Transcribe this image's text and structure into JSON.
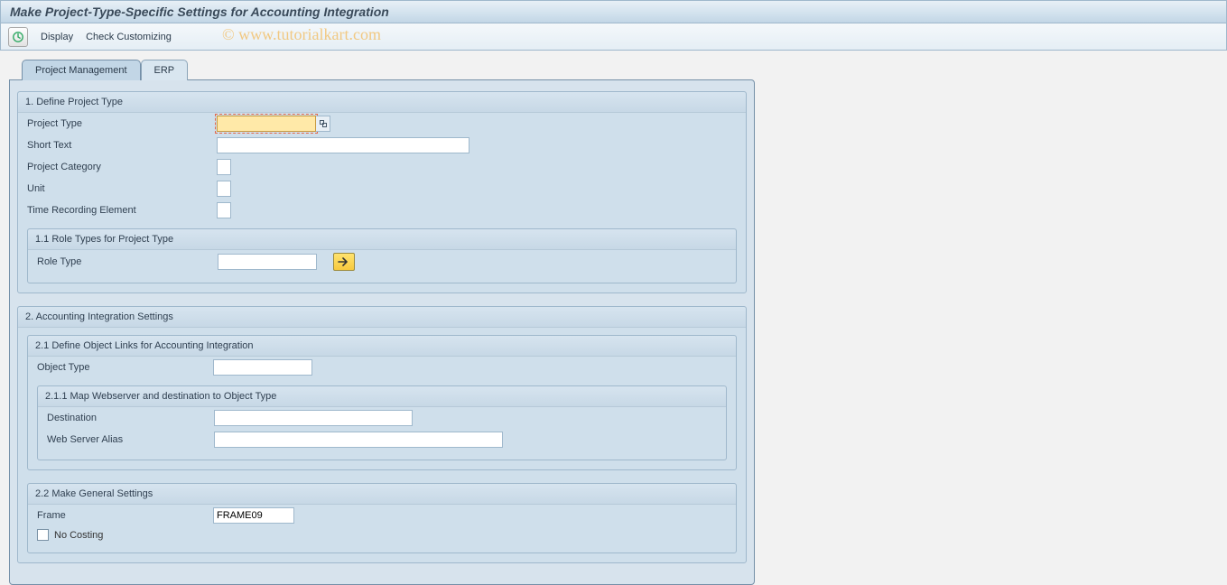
{
  "title": "Make Project-Type-Specific Settings for Accounting Integration",
  "toolbar": {
    "display": "Display",
    "check": "Check Customizing"
  },
  "watermark": "© www.tutorialkart.com",
  "tabs": {
    "pm": "Project Management",
    "erp": "ERP"
  },
  "section1": {
    "title": "1. Define Project Type",
    "project_type": "Project Type",
    "short_text": "Short Text",
    "project_category": "Project Category",
    "unit": "Unit",
    "time_rec": "Time Recording Element",
    "sub11_title": "1.1 Role Types for Project Type",
    "role_type": "Role Type"
  },
  "section2": {
    "title": "2. Accounting Integration Settings",
    "sub21_title": "2.1 Define Object Links for Accounting Integration",
    "object_type": "Object Type",
    "sub211_title": "2.1.1 Map Webserver and destination to Object Type",
    "destination": "Destination",
    "web_alias": "Web Server Alias",
    "sub22_title": "2.2 Make General Settings",
    "frame": "Frame",
    "frame_value": "FRAME09",
    "no_costing": "No Costing"
  }
}
